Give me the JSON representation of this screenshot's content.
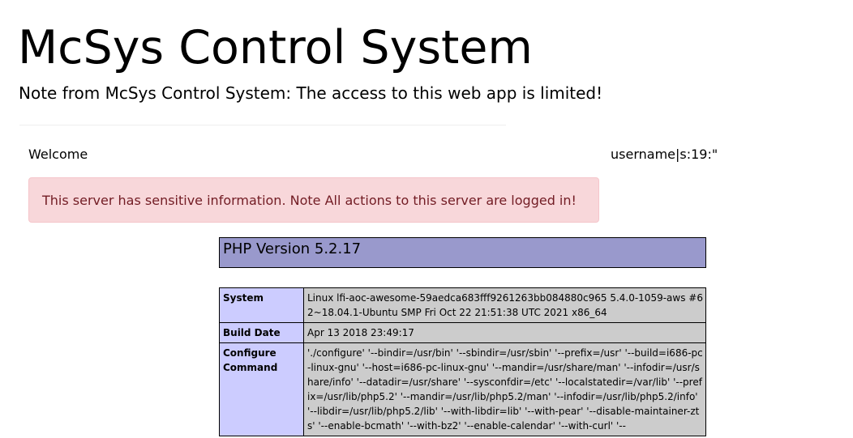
{
  "header": {
    "title": "McSys Control System",
    "note": "Note from McSys Control System: The access to this web app is limited!"
  },
  "welcome": {
    "label": "Welcome",
    "username": "username|s:19:\""
  },
  "alert": {
    "message": "This server has sensitive information. Note All actions to this server are logged in!"
  },
  "phpinfo": {
    "version_title": "PHP Version 5.2.17",
    "rows": [
      {
        "label": "System",
        "value": "Linux lfi-aoc-awesome-59aedca683fff9261263bb084880c965 5.4.0-1059-aws #62~18.04.1-Ubuntu SMP Fri Oct 22 21:51:38 UTC 2021 x86_64"
      },
      {
        "label": "Build Date",
        "value": "Apr 13 2018 23:49:17"
      },
      {
        "label": "Configure Command",
        "value": "'./configure' '--bindir=/usr/bin' '--sbindir=/usr/sbin' '--prefix=/usr' '--build=i686-pc-linux-gnu' '--host=i686-pc-linux-gnu' '--mandir=/usr/share/man' '--infodir=/usr/share/info' '--datadir=/usr/share' '--sysconfdir=/etc' '--localstatedir=/var/lib' '--prefix=/usr/lib/php5.2' '--mandir=/usr/lib/php5.2/man' '--infodir=/usr/lib/php5.2/info' '--libdir=/usr/lib/php5.2/lib' '--with-libdir=lib' '--with-pear' '--disable-maintainer-zts' '--enable-bcmath' '--with-bz2' '--enable-calendar' '--with-curl' '--"
      }
    ]
  },
  "colors": {
    "alert_background": "#f8d7da",
    "alert_text": "#721c24",
    "php_header": "#9999cc",
    "php_label_cell": "#ccccff",
    "php_value_cell": "#cccccc"
  }
}
